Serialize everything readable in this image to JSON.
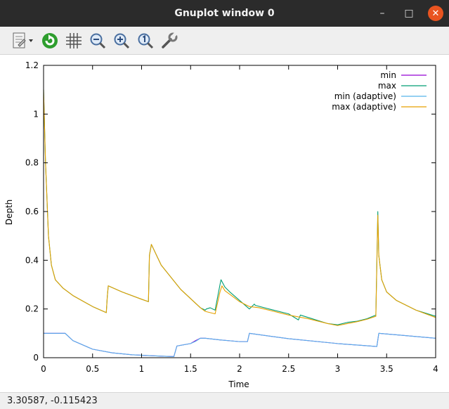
{
  "window": {
    "title": "Gnuplot window 0",
    "minimize_glyph": "–",
    "maximize_glyph": "□",
    "close_glyph": "✕"
  },
  "toolbar": {
    "icons": [
      "clipboard-export-icon",
      "replot-icon",
      "grid-icon",
      "zoom-out-icon",
      "zoom-in-icon",
      "zoom-previous-icon",
      "settings-wrench-icon"
    ]
  },
  "status": {
    "coords": "3.30587, -0.115423"
  },
  "colors": {
    "min": "#9400d3",
    "max": "#009e73",
    "min_adaptive": "#56b4e9",
    "max_adaptive": "#e6a100",
    "lower": "#6a6ae0"
  },
  "chart_data": {
    "type": "line",
    "xlabel": "Time",
    "ylabel": "Depth",
    "xlim": [
      0,
      4
    ],
    "ylim": [
      0,
      1.2
    ],
    "xticks": [
      "0",
      "0.5",
      "1",
      "1.5",
      "2",
      "2.5",
      "3",
      "3.5",
      "4"
    ],
    "yticks": [
      "0",
      "0.2",
      "0.4",
      "0.6",
      "0.8",
      "1",
      "1.2"
    ],
    "legend_position": "top-right",
    "series": [
      {
        "name": "min",
        "color": "#9400d3",
        "x": [
          0,
          0.1,
          0.22,
          0.3,
          0.5,
          0.7,
          0.9,
          1.1,
          1.3,
          1.33,
          1.36,
          1.5,
          1.55,
          1.6,
          1.65,
          1.8,
          2.0,
          2.08,
          2.1,
          2.5,
          3.0,
          3.4,
          3.42,
          3.6,
          4.0
        ],
        "y": [
          0.1,
          0.1,
          0.1,
          0.07,
          0.035,
          0.02,
          0.012,
          0.008,
          0.005,
          0.005,
          0.048,
          0.058,
          0.07,
          0.08,
          0.08,
          0.073,
          0.066,
          0.066,
          0.1,
          0.078,
          0.058,
          0.046,
          0.1,
          0.094,
          0.08
        ]
      },
      {
        "name": "max",
        "color": "#009e73",
        "x": [
          0,
          0.02,
          0.05,
          0.08,
          0.12,
          0.2,
          0.3,
          0.5,
          0.64,
          0.65,
          0.66,
          0.8,
          1.0,
          1.07,
          1.08,
          1.1,
          1.2,
          1.4,
          1.6,
          1.65,
          1.66,
          1.7,
          1.75,
          1.8,
          1.81,
          1.85,
          1.9,
          2.0,
          2.1,
          2.15,
          2.16,
          2.3,
          2.5,
          2.6,
          2.62,
          2.7,
          2.9,
          3.0,
          3.1,
          3.2,
          3.3,
          3.39,
          3.41,
          3.42,
          3.45,
          3.5,
          3.6,
          3.8,
          4.0
        ],
        "y": [
          1.1,
          0.8,
          0.5,
          0.38,
          0.32,
          0.285,
          0.255,
          0.21,
          0.185,
          0.25,
          0.295,
          0.27,
          0.24,
          0.23,
          0.42,
          0.465,
          0.38,
          0.28,
          0.205,
          0.195,
          0.2,
          0.205,
          0.195,
          0.3,
          0.32,
          0.29,
          0.27,
          0.235,
          0.2,
          0.22,
          0.215,
          0.2,
          0.18,
          0.155,
          0.175,
          0.165,
          0.14,
          0.135,
          0.145,
          0.15,
          0.16,
          0.175,
          0.6,
          0.42,
          0.32,
          0.27,
          0.235,
          0.195,
          0.17
        ]
      },
      {
        "name": "min (adaptive)",
        "color": "#56b4e9",
        "x": [
          0,
          0.1,
          0.22,
          0.3,
          0.5,
          0.7,
          0.9,
          1.1,
          1.3,
          1.33,
          1.36,
          1.5,
          1.55,
          1.6,
          1.65,
          1.8,
          2.0,
          2.08,
          2.1,
          2.5,
          3.0,
          3.4,
          3.42,
          3.6,
          4.0
        ],
        "y": [
          0.1,
          0.1,
          0.1,
          0.07,
          0.035,
          0.02,
          0.012,
          0.008,
          0.005,
          0.005,
          0.048,
          0.058,
          0.067,
          0.08,
          0.08,
          0.073,
          0.066,
          0.066,
          0.1,
          0.078,
          0.058,
          0.046,
          0.1,
          0.094,
          0.08
        ]
      },
      {
        "name": "max (adaptive)",
        "color": "#e6a100",
        "x": [
          0,
          0.02,
          0.05,
          0.08,
          0.12,
          0.2,
          0.3,
          0.5,
          0.64,
          0.65,
          0.66,
          0.8,
          1.0,
          1.07,
          1.08,
          1.1,
          1.2,
          1.4,
          1.6,
          1.65,
          1.7,
          1.75,
          1.8,
          1.82,
          1.85,
          1.9,
          2.0,
          2.1,
          2.2,
          2.3,
          2.5,
          2.7,
          2.9,
          3.0,
          3.1,
          3.2,
          3.3,
          3.39,
          3.41,
          3.42,
          3.45,
          3.5,
          3.6,
          3.8,
          4.0
        ],
        "y": [
          1.1,
          0.8,
          0.5,
          0.38,
          0.32,
          0.285,
          0.255,
          0.21,
          0.185,
          0.25,
          0.295,
          0.27,
          0.24,
          0.23,
          0.42,
          0.465,
          0.38,
          0.28,
          0.205,
          0.19,
          0.185,
          0.18,
          0.27,
          0.295,
          0.275,
          0.26,
          0.23,
          0.21,
          0.205,
          0.195,
          0.175,
          0.16,
          0.14,
          0.132,
          0.14,
          0.148,
          0.158,
          0.17,
          0.585,
          0.42,
          0.32,
          0.27,
          0.235,
          0.195,
          0.165
        ]
      }
    ]
  }
}
